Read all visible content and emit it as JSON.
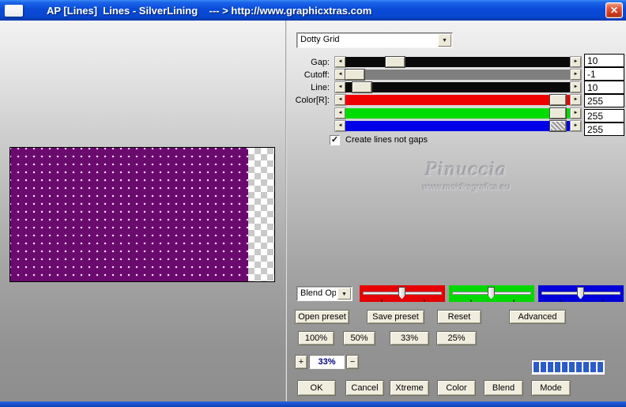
{
  "window": {
    "title": "AP [Lines]  Lines - SilverLining    --- > http://www.graphicxtras.com"
  },
  "icons": {
    "close": "✕",
    "arrow_left": "◄",
    "arrow_right": "►",
    "arrow_down": "▼",
    "check": "✓",
    "plus": "+",
    "minus": "−"
  },
  "preset_dropdown": {
    "value": "Dotty Grid"
  },
  "sliders": [
    {
      "label": "Gap:",
      "value": "10",
      "track_color": "#0a0a0a",
      "thumb_left": "18%"
    },
    {
      "label": "Cutoff:",
      "value": "-1",
      "track_color": "#7f7f7f",
      "thumb_left": "0%"
    },
    {
      "label": "Line:",
      "value": "10",
      "track_color": "#0a0a0a",
      "thumb_left": "3%"
    },
    {
      "label": "Color[R]:",
      "value": "255",
      "track_color": "#ee0000",
      "thumb_left": "91%"
    },
    {
      "label": "",
      "value": "255",
      "track_color": "#00dc00",
      "thumb_left": "91%"
    },
    {
      "label": "",
      "value": "255",
      "track_color": "#0000e8",
      "thumb_left": "91%"
    }
  ],
  "options": {
    "create_lines_label": "Create lines not gaps",
    "checked": true
  },
  "watermark": {
    "name": "Pinuccia",
    "site": "www.maidiregrafica.eu"
  },
  "blend": {
    "dropdown_value": "Blend Optio",
    "sliders": [
      {
        "name": "red",
        "color": "#e60000",
        "thumb_left": "50%"
      },
      {
        "name": "green",
        "color": "#00d800",
        "thumb_left": "50%"
      },
      {
        "name": "blue",
        "color": "#0000d8",
        "thumb_left": "50%"
      }
    ]
  },
  "preset_buttons": [
    "Open preset",
    "Save preset",
    "Reset",
    "Advanced"
  ],
  "zoom_preset_buttons": [
    "100%",
    "50%",
    "33%",
    "25%"
  ],
  "zoom_control": {
    "value": "33%"
  },
  "progress": {
    "segments": 10,
    "color": "#2b5cc8"
  },
  "action_buttons": [
    "OK",
    "Cancel",
    "Xtreme",
    "Color",
    "Blend",
    "Mode"
  ],
  "preview": {
    "background": "#6b0a6e"
  }
}
